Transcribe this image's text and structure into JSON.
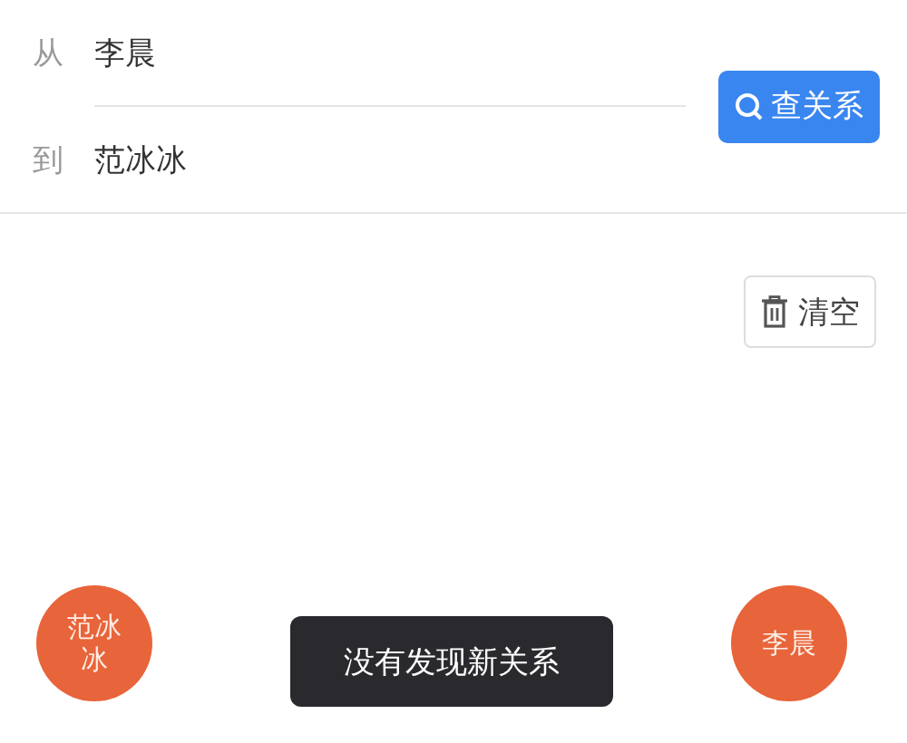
{
  "query": {
    "from_label": "从",
    "from_value": "李晨",
    "to_label": "到",
    "to_value": "范冰冰",
    "search_button": "查关系"
  },
  "clear_button": "清空",
  "graph": {
    "nodes": [
      {
        "label": "范冰冰"
      },
      {
        "label": "李晨"
      }
    ]
  },
  "toast": "没有发现新关系"
}
